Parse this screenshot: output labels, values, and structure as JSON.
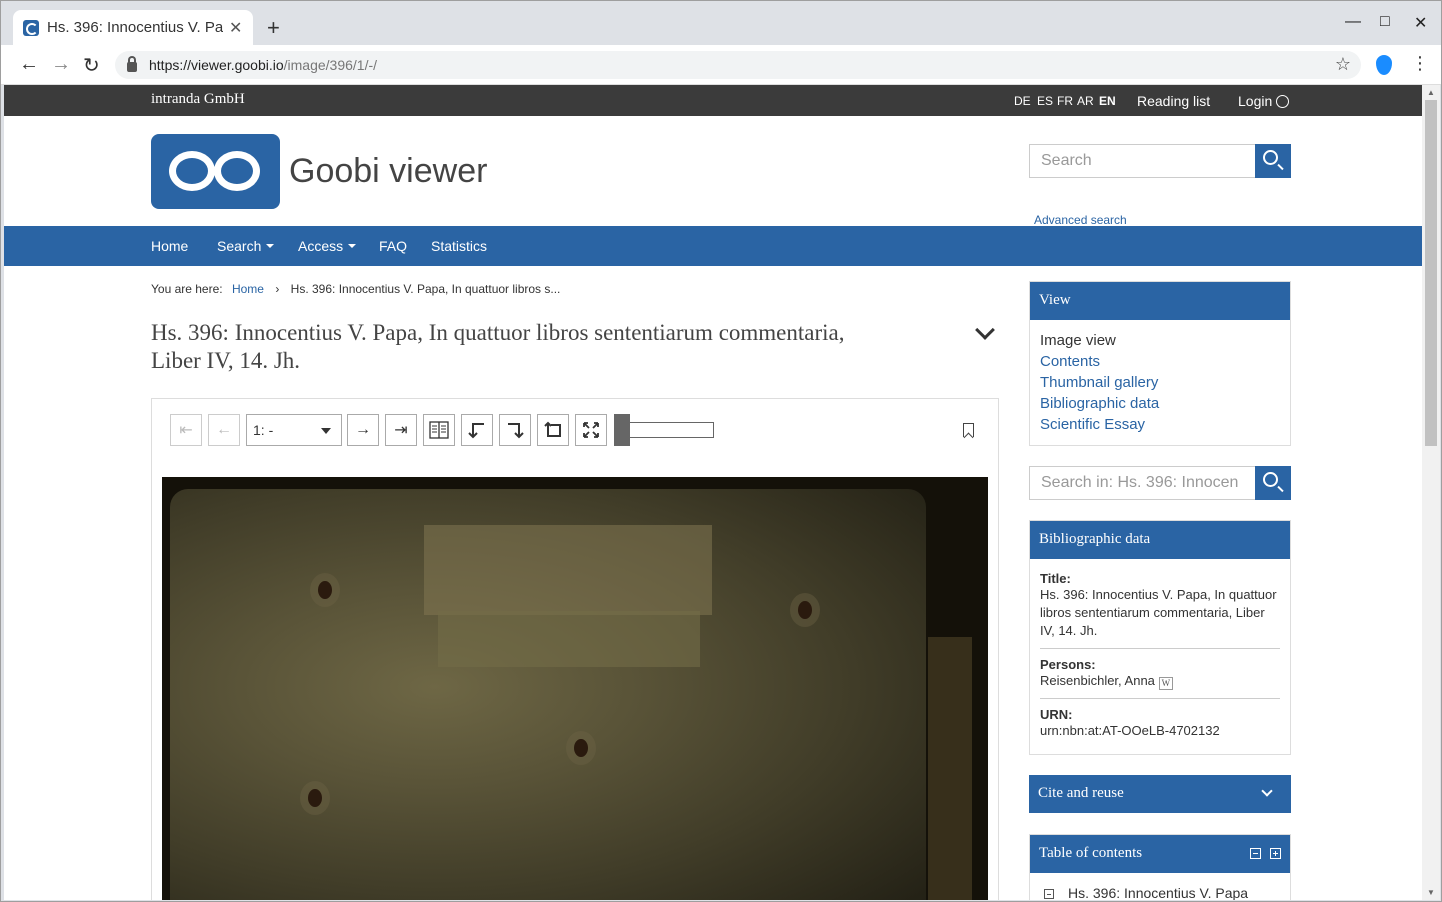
{
  "browser": {
    "tab_title": "Hs. 396: Innocentius V. Pa",
    "tab_close": "✕",
    "new_tab": "+",
    "url_host": "https://viewer.goobi.io",
    "url_path": "/image/396/1/-/",
    "min_glyph": "—",
    "max_glyph": "□",
    "close_glyph": "✕"
  },
  "topbar": {
    "brand": "intranda GmbH",
    "languages": [
      "DE",
      "ES",
      "FR",
      "AR",
      "EN"
    ],
    "active_language": "EN",
    "reading_list": "Reading list",
    "login": "Login"
  },
  "header": {
    "site_name": "Goobi viewer",
    "search_placeholder": "Search",
    "advanced_search": "Advanced search"
  },
  "nav": {
    "items": [
      "Home",
      "Search",
      "Access",
      "FAQ",
      "Statistics"
    ]
  },
  "breadcrumb": {
    "prefix": "You are here:",
    "home": "Home",
    "separator": "›",
    "current": "Hs. 396: Innocentius V. Papa, In quattuor libros s..."
  },
  "document": {
    "title": "Hs. 396: Innocentius V. Papa, In quattuor libros sententiarum commentaria, Liber IV, 14. Jh."
  },
  "viewer": {
    "page_select_value": "1: -",
    "first_glyph": "⇤",
    "prev_glyph": "←",
    "next_glyph": "→",
    "last_glyph": "⇥",
    "zoom_level": 0
  },
  "sidebar": {
    "view": {
      "heading": "View",
      "current": "Image view",
      "links": [
        "Contents",
        "Thumbnail gallery",
        "Bibliographic data",
        "Scientific Essay"
      ]
    },
    "search_in_placeholder": "Search in: Hs. 396: Innocen",
    "bibliographic": {
      "heading": "Bibliographic data",
      "title_label": "Title:",
      "title_value": "Hs. 396: Innocentius V. Papa, In quattuor libros sententiarum commentaria, Liber IV, 14. Jh.",
      "persons_label": "Persons:",
      "persons_value": "Reisenbichler, Anna",
      "wiki_glyph": "W",
      "urn_label": "URN:",
      "urn_value": "urn:nbn:at:AT-OOeLB-4702132"
    },
    "cite": {
      "heading": "Cite and reuse"
    },
    "toc": {
      "heading": "Table of contents",
      "first_entry": "Hs. 396: Innocentius V. Papa"
    }
  },
  "colors": {
    "brand_blue": "#2a64a4",
    "topbar_dark": "#3b3b3b"
  }
}
